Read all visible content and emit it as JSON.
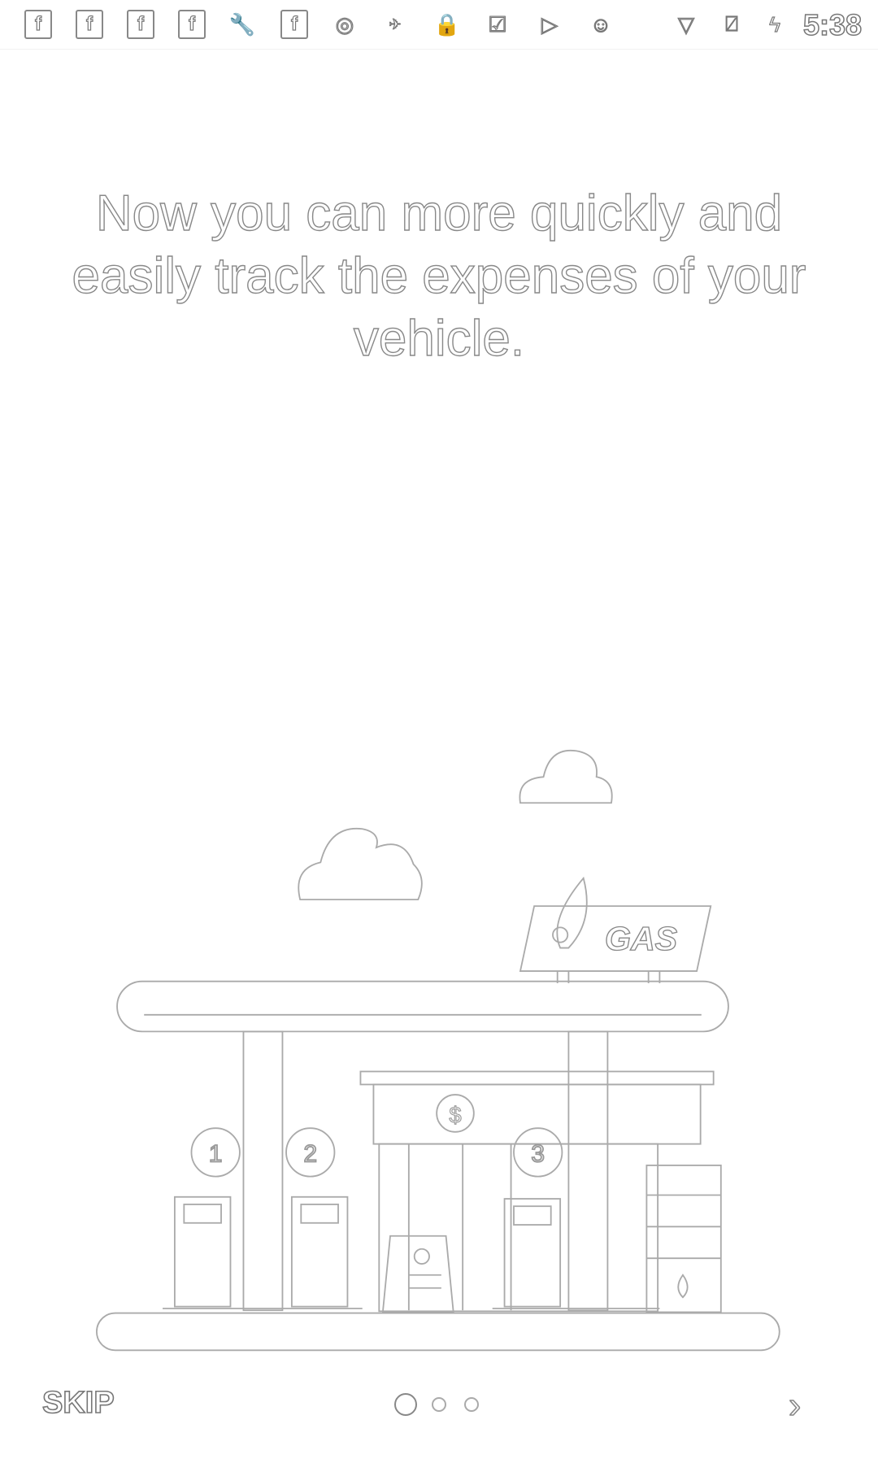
{
  "status_bar": {
    "time": "5:38",
    "icons": [
      "facebook-icon",
      "facebook-icon",
      "facebook-icon",
      "facebook-icon",
      "wrench-icon",
      "facebook-icon",
      "opera-icon",
      "fax-icon",
      "lock-icon",
      "clipboard-check-icon",
      "play-store-icon",
      "android-icon",
      "wifi-icon",
      "no-sim-icon",
      "battery-charging-icon"
    ]
  },
  "onboarding": {
    "headline": "Now you can more quickly and easily track the expenses of your vehicle.",
    "illustration": {
      "sign_label": "GAS",
      "pump_numbers": [
        "1",
        "2",
        "3"
      ],
      "store_symbol": "$"
    },
    "page_indicator": {
      "current": 1,
      "total": 3
    },
    "skip_label": "SKIP",
    "next_icon": "chevron-right-icon"
  }
}
